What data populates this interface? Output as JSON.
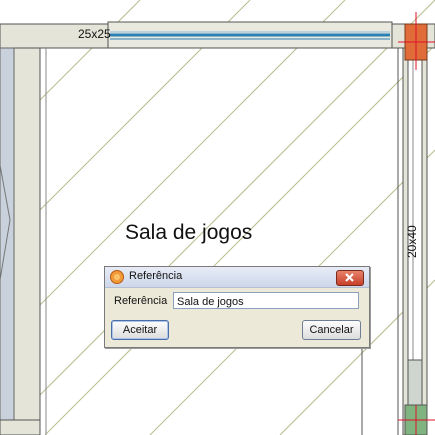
{
  "plan": {
    "room_label": "Sala de jogos",
    "dimension_top_beam": "25x25",
    "dimension_right_wall": "20x40"
  },
  "dialog": {
    "title": "Referência",
    "field_label": "Referência",
    "field_value": "Sala de jogos",
    "ok_label": "Aceitar",
    "cancel_label": "Cancelar",
    "close_icon": "close-icon",
    "app_icon": "app-icon"
  },
  "colors": {
    "wall_fill": "#e4e4d8",
    "hatch_line": "#b7bd8e",
    "left_panel": "#c9d1dc",
    "beam_line": "#2a7fb3",
    "column_fill": "#e06c3a",
    "crosshair": "#e0102a",
    "dialog_bg": "#ece9d8"
  }
}
